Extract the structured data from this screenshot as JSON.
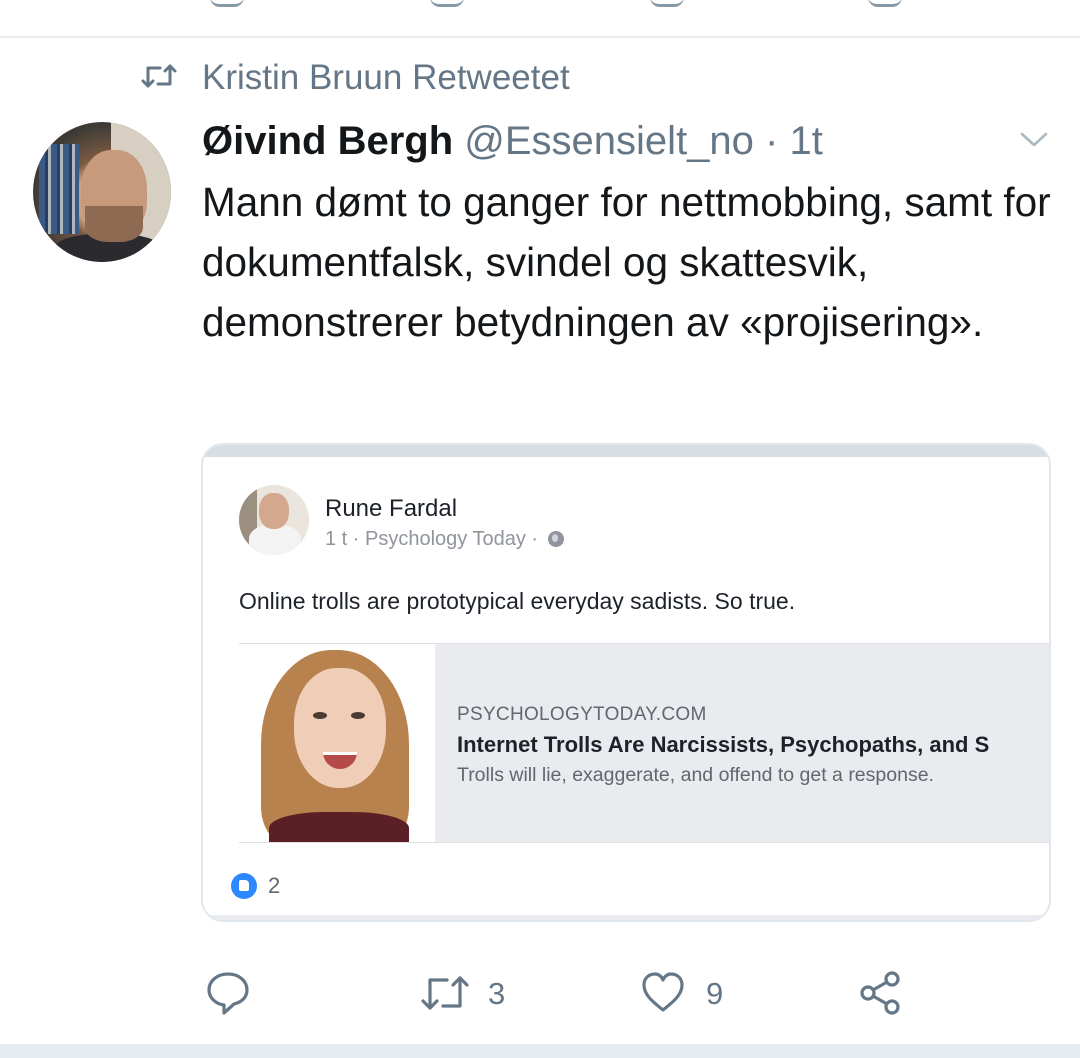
{
  "retweet": {
    "label": "Kristin Bruun Retweetet"
  },
  "tweet": {
    "name": "Øivind Bergh",
    "handle": "@Essensielt_no",
    "separator": " · ",
    "time": "1t",
    "text": "Mann dømt to ganger for nettmobbing, samt for dokumentfalsk, svindel og skattesvik, demonstrerer betydningen av «projisering».",
    "embed": {
      "author": "Rune Fardal",
      "meta": "1 t · Psychology Today · ",
      "post_text": "Online trolls are prototypical everyday sadists. So true.",
      "link": {
        "domain": "PSYCHOLOGYTODAY.COM",
        "title": "Internet Trolls Are Narcissists, Psychopaths, and S",
        "description": "Trolls will lie, exaggerate, and offend to get a response."
      },
      "likes": "2"
    },
    "actions": {
      "reply_icon": "reply-icon",
      "retweet_icon": "retweet-icon",
      "retweet_count": "3",
      "like_icon": "heart-icon",
      "like_count": "9",
      "share_icon": "share-icon"
    }
  },
  "colors": {
    "secondary_text": "#657786",
    "divider": "#e6ecf0",
    "fb_blue": "#2d88ff"
  }
}
